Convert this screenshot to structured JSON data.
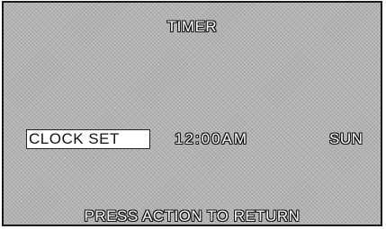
{
  "screen": {
    "title": "TIMER",
    "clock_set_label": "CLOCK SET",
    "time": "12:00AM",
    "day": "SUN",
    "footer": "PRESS ACTION TO RETURN"
  }
}
